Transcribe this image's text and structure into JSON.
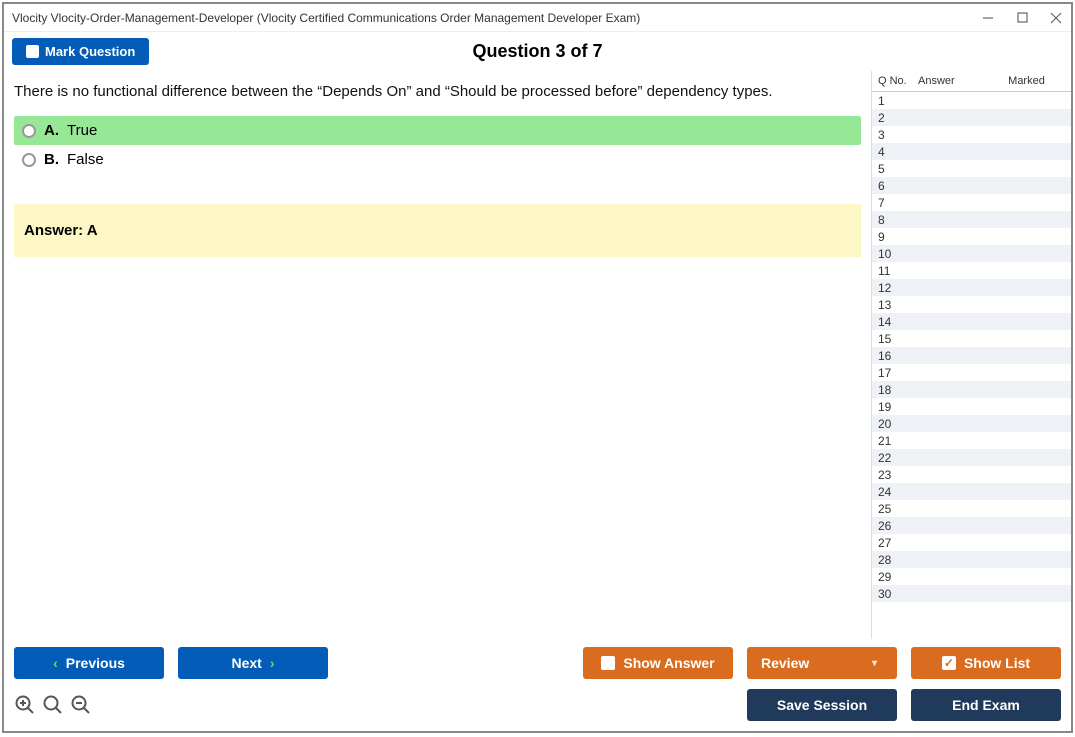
{
  "window": {
    "title": "Vlocity Vlocity-Order-Management-Developer (Vlocity Certified Communications Order Management Developer Exam)"
  },
  "header": {
    "mark_label": "Mark Question",
    "question_title": "Question 3 of 7"
  },
  "question": {
    "text": "There is no functional difference between the “Depends On” and “Should be processed before” dependency types.",
    "options": [
      {
        "letter": "A.",
        "text": "True",
        "selected": true
      },
      {
        "letter": "B.",
        "text": "False",
        "selected": false
      }
    ],
    "answer_label": "Answer: A"
  },
  "side": {
    "headers": {
      "qno": "Q No.",
      "answer": "Answer",
      "marked": "Marked"
    },
    "rows": [
      1,
      2,
      3,
      4,
      5,
      6,
      7,
      8,
      9,
      10,
      11,
      12,
      13,
      14,
      15,
      16,
      17,
      18,
      19,
      20,
      21,
      22,
      23,
      24,
      25,
      26,
      27,
      28,
      29,
      30
    ]
  },
  "footer": {
    "prev": "Previous",
    "next": "Next",
    "show_answer": "Show Answer",
    "review": "Review",
    "show_list": "Show List",
    "save_session": "Save Session",
    "end_exam": "End Exam"
  }
}
